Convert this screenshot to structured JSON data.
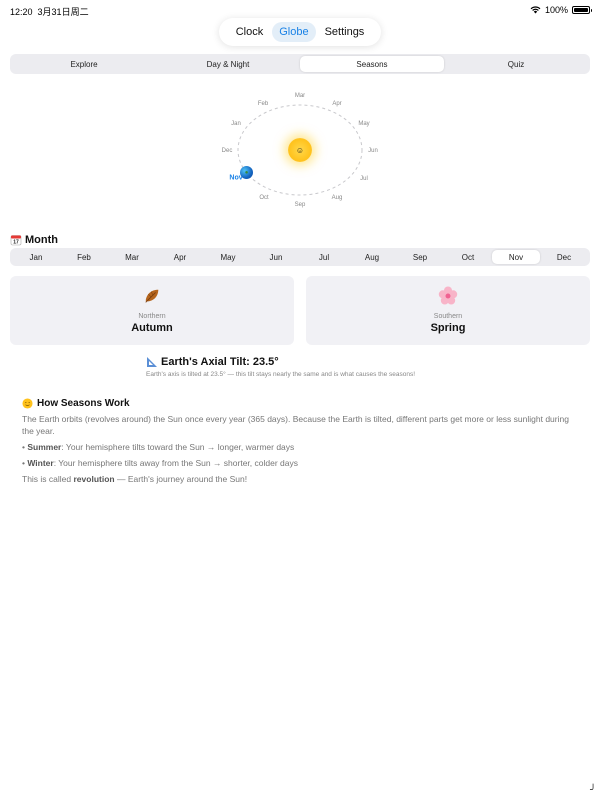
{
  "status": {
    "time": "12:20",
    "date": "3月31日周二",
    "battery": "100%",
    "battery_level": 1.0
  },
  "top_nav": [
    "Clock",
    "Globe",
    "Settings"
  ],
  "top_nav_active": "Globe",
  "tabs": [
    "Explore",
    "Day & Night",
    "Seasons",
    "Quiz"
  ],
  "tabs_active": "Seasons",
  "orbit": {
    "months": [
      "Jan",
      "Feb",
      "Mar",
      "Apr",
      "May",
      "Jun",
      "Jul",
      "Aug",
      "Sep",
      "Oct",
      "Nov",
      "Dec"
    ],
    "current": "Nov"
  },
  "month_section": {
    "title": "Month",
    "months": [
      "Jan",
      "Feb",
      "Mar",
      "Apr",
      "May",
      "Jun",
      "Jul",
      "Aug",
      "Sep",
      "Oct",
      "Nov",
      "Dec"
    ],
    "selected": "Nov"
  },
  "hemispheres": {
    "northern": {
      "label": "Northern",
      "season": "Autumn",
      "icon": "fallen-leaf-icon"
    },
    "southern": {
      "label": "Southern",
      "season": "Spring",
      "icon": "cherry-blossom-icon"
    }
  },
  "tilt": {
    "title": "Earth's Axial Tilt: 23.5°",
    "desc": "Earth's axis is tilted at 23.5° — this tilt stays nearly the same and is what causes the seasons!"
  },
  "how": {
    "title": "How Seasons Work",
    "intro": "The Earth orbits (revolves around) the Sun once every year (365 days). Because the Earth is tilted, different parts get more or less sunlight during the year.",
    "summer_label": "Summer",
    "summer_text": ": Your hemisphere tilts toward the Sun → longer, warmer days",
    "winter_label": "Winter",
    "winter_text": ": Your hemisphere tilts away from the Sun → shorter, colder days",
    "revolution_pre": "This is called ",
    "revolution_word": "revolution",
    "revolution_post": " — Earth's journey around the Sun!"
  },
  "colors": {
    "accent": "#1a82e6",
    "segment_bg": "#ececf0",
    "card_bg": "#f1f1f5"
  }
}
